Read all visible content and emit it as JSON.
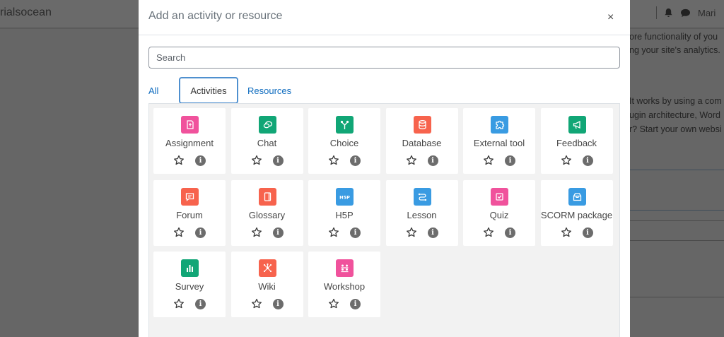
{
  "background": {
    "brand": "rialsocean",
    "user": "Mari",
    "lines": [
      "ore functionality of you",
      "ng your site's analytics.",
      "It works by using a com",
      "ugin architecture, Word",
      "r? Start your own websi"
    ]
  },
  "modal": {
    "title": "Add an activity or resource",
    "close_label": "×",
    "search_placeholder": "Search",
    "tabs": [
      {
        "label": "All",
        "active": false
      },
      {
        "label": "Activities",
        "active": true
      },
      {
        "label": "Resources",
        "active": false
      }
    ],
    "items": [
      {
        "label": "Assignment",
        "icon": "assignment-icon",
        "color": "#f0529c"
      },
      {
        "label": "Chat",
        "icon": "chat-icon",
        "color": "#11a676"
      },
      {
        "label": "Choice",
        "icon": "choice-icon",
        "color": "#11a676"
      },
      {
        "label": "Database",
        "icon": "database-icon",
        "color": "#f7634d"
      },
      {
        "label": "External tool",
        "icon": "puzzle-icon",
        "color": "#399be2"
      },
      {
        "label": "Feedback",
        "icon": "megaphone-icon",
        "color": "#11a676"
      },
      {
        "label": "Forum",
        "icon": "forum-icon",
        "color": "#f7634d"
      },
      {
        "label": "Glossary",
        "icon": "book-icon",
        "color": "#f7634d"
      },
      {
        "label": "H5P",
        "icon": "h5p-icon",
        "color": "#399be2"
      },
      {
        "label": "Lesson",
        "icon": "lesson-icon",
        "color": "#399be2"
      },
      {
        "label": "Quiz",
        "icon": "quiz-icon",
        "color": "#f0529c"
      },
      {
        "label": "SCORM package",
        "icon": "package-icon",
        "color": "#399be2"
      },
      {
        "label": "Survey",
        "icon": "chart-icon",
        "color": "#11a676"
      },
      {
        "label": "Wiki",
        "icon": "wiki-icon",
        "color": "#f7634d"
      },
      {
        "label": "Workshop",
        "icon": "workshop-icon",
        "color": "#f0529c"
      }
    ],
    "info_glyph": "i"
  }
}
